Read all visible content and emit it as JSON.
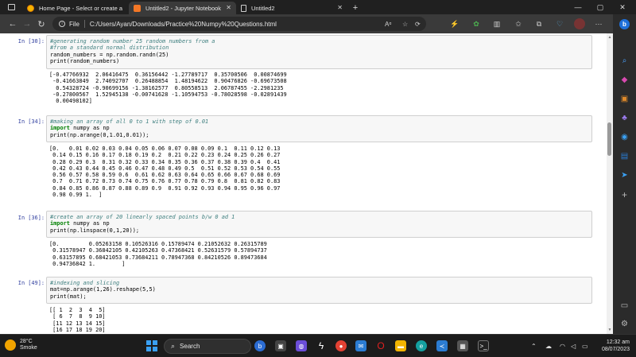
{
  "browser": {
    "tabs": [
      {
        "title": "Home Page - Select or create a n",
        "favicon": "home-icon",
        "active": false
      },
      {
        "title": "Untitled2 - Jupyter Notebook",
        "favicon": "jupyter-icon",
        "active": true
      },
      {
        "title": "Untitled2",
        "favicon": "document-icon",
        "active": false
      }
    ],
    "new_tab": "+",
    "window_controls": {
      "minimize": "—",
      "maximize": "▢",
      "close": "✕"
    },
    "address": {
      "label": "File",
      "url": "C:/Users/Ayan/Downloads/Practice%20Numpy%20Questions.html"
    }
  },
  "notebook": {
    "cells": [
      {
        "prompt": "In [30]:",
        "code": [
          {
            "type": "comment",
            "text": "#generating random number 25 random numbers from a"
          },
          {
            "type": "comment",
            "text": "#from a standard normal distribution"
          },
          {
            "type": "plain",
            "text": "random_numbers = np.random.randn(25)"
          },
          {
            "type": "plain",
            "text": "print(random_numbers)"
          }
        ],
        "output": "[-0.47766932  2.06416475  0.36156442 -1.27789717  0.35700506  0.00874699\n -0.41663849  2.74092707  0.26488854  1.48194622  0.90476826 -0.69673508\n  0.54328724 -0.90699156 -1.38162577  0.80558513  2.06787455 -2.2981235\n -0.27800567  1.52945138 -0.00741628 -1.10594753 -0.78028598 -0.02891439\n  0.00498102]"
      },
      {
        "prompt": "In [34]:",
        "code": [
          {
            "type": "comment",
            "text": "#making an array of all 0 to 1 with step of 0.01"
          },
          {
            "type": "import",
            "text": "numpy as np"
          },
          {
            "type": "plain",
            "text": "print(np.arange(0,1.01,0.01));"
          }
        ],
        "output": "[0.   0.01 0.02 0.03 0.04 0.05 0.06 0.07 0.08 0.09 0.1  0.11 0.12 0.13\n 0.14 0.15 0.16 0.17 0.18 0.19 0.2  0.21 0.22 0.23 0.24 0.25 0.26 0.27\n 0.28 0.29 0.3  0.31 0.32 0.33 0.34 0.35 0.36 0.37 0.38 0.39 0.4  0.41\n 0.42 0.43 0.44 0.45 0.46 0.47 0.48 0.49 0.5  0.51 0.52 0.53 0.54 0.55\n 0.56 0.57 0.58 0.59 0.6  0.61 0.62 0.63 0.64 0.65 0.66 0.67 0.68 0.69\n 0.7  0.71 0.72 0.73 0.74 0.75 0.76 0.77 0.78 0.79 0.8  0.81 0.82 0.83\n 0.84 0.85 0.86 0.87 0.88 0.89 0.9  0.91 0.92 0.93 0.94 0.95 0.96 0.97\n 0.98 0.99 1.  ]"
      },
      {
        "prompt": "In [36]:",
        "code": [
          {
            "type": "comment",
            "text": "#create an array of 20 linearly spaced points b/w 0 ad 1"
          },
          {
            "type": "import",
            "text": "numpy as np"
          },
          {
            "type": "plain",
            "text": "print(np.linspace(0,1,20));"
          }
        ],
        "output": "[0.         0.05263158 0.10526316 0.15789474 0.21052632 0.26315789\n 0.31578947 0.36842105 0.42105263 0.47368421 0.52631579 0.57894737\n 0.63157895 0.68421053 0.73684211 0.78947368 0.84210526 0.89473684\n 0.94736842 1.        ]"
      },
      {
        "prompt": "In [49]:",
        "code": [
          {
            "type": "comment",
            "text": "#indexing and slicing"
          },
          {
            "type": "plain",
            "text": "mat=np.arange(1,26).reshape(5,5)"
          },
          {
            "type": "plain",
            "text": "print(mat);"
          }
        ],
        "output": "[[ 1  2  3  4  5]\n [ 6  7  8  9 10]\n [11 12 13 14 15]\n [16 17 18 19 20]"
      }
    ]
  },
  "taskbar": {
    "weather": {
      "temp": "28°C",
      "condition": "Smoke"
    },
    "search_label": "Search",
    "time": "12:32 am",
    "date": "08/07/2023"
  },
  "colors": {
    "accent": "#3aa0f3",
    "prompt": "#303f9f",
    "comment": "#408080",
    "keyword": "#008000"
  }
}
